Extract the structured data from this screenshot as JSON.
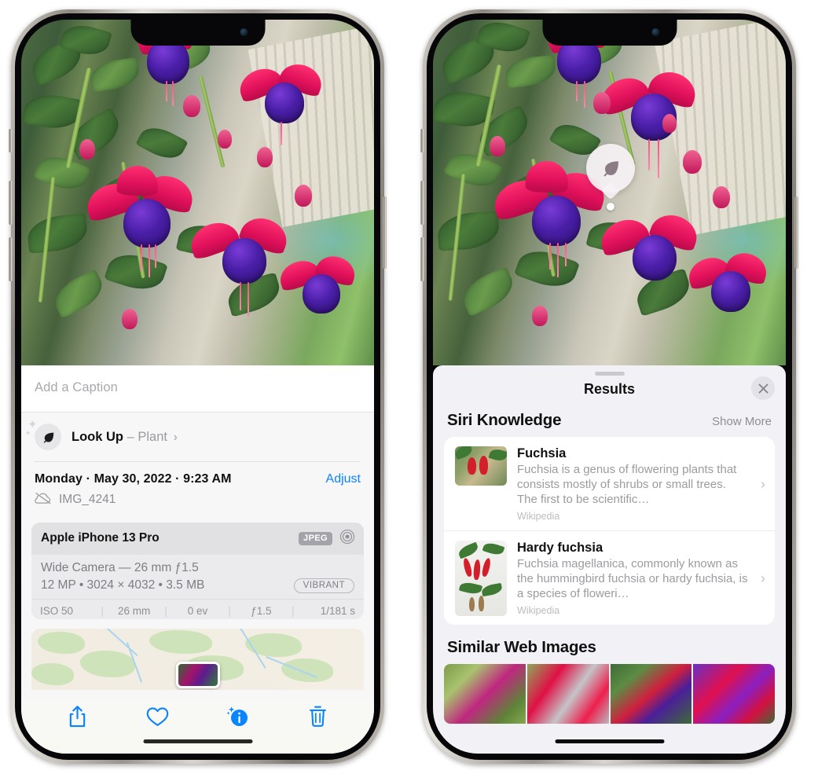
{
  "left_phone": {
    "photo": {
      "alt": "fuchsia-flowers-photo"
    },
    "caption": {
      "placeholder": "Add a Caption",
      "value": ""
    },
    "look_up": {
      "label": "Look Up",
      "dash": "–",
      "subject": "Plant",
      "chevron": "›",
      "icon": "leaf-icon"
    },
    "meta": {
      "date": "Monday · May 30, 2022 · 9:23 AM",
      "adjust_label": "Adjust",
      "filename": "IMG_4241",
      "cloud_icon": "icloud-slash-icon"
    },
    "exif": {
      "device": "Apple iPhone 13 Pro",
      "format_badge": "JPEG",
      "aperture_icon": "lens-icon",
      "lens": "Wide Camera — 26 mm ƒ1.5",
      "dimensions": "12 MP • 3024 × 4032 • 3.5 MB",
      "style_badge": "VIBRANT",
      "stats": [
        "ISO 50",
        "26 mm",
        "0 ev",
        "ƒ1.5",
        "1/181 s"
      ]
    },
    "map": {
      "alt": "photo-location-map"
    },
    "toolbar": [
      {
        "name": "share-button",
        "icon": "share-icon"
      },
      {
        "name": "favorite-button",
        "icon": "heart-icon"
      },
      {
        "name": "info-button",
        "icon": "info-sparkle-icon"
      },
      {
        "name": "delete-button",
        "icon": "trash-icon"
      }
    ],
    "accent_color": "#0a84ff"
  },
  "right_phone": {
    "photo": {
      "alt": "fuchsia-flowers-photo"
    },
    "leaf_badge": {
      "icon": "leaf-icon",
      "label": ""
    },
    "sheet": {
      "title": "Results",
      "close_icon": "close-icon",
      "siri_knowledge": {
        "title": "Siri Knowledge",
        "show_more": "Show More",
        "items": [
          {
            "title": "Fuchsia",
            "description": "Fuchsia is a genus of flowering plants that consists mostly of shrubs or small trees. The first to be scientific…",
            "source": "Wikipedia",
            "chevron": "›"
          },
          {
            "title": "Hardy fuchsia",
            "description": "Fuchsia magellanica, commonly known as the hummingbird fuchsia or hardy fuchsia, is a species of floweri…",
            "source": "Wikipedia",
            "chevron": "›"
          }
        ]
      },
      "similar_web_images": {
        "title": "Similar Web Images",
        "items": [
          {
            "alt": "fuchsia-web-image-1"
          },
          {
            "alt": "fuchsia-web-image-2"
          },
          {
            "alt": "fuchsia-web-image-3"
          },
          {
            "alt": "fuchsia-web-image-4"
          }
        ]
      }
    }
  }
}
